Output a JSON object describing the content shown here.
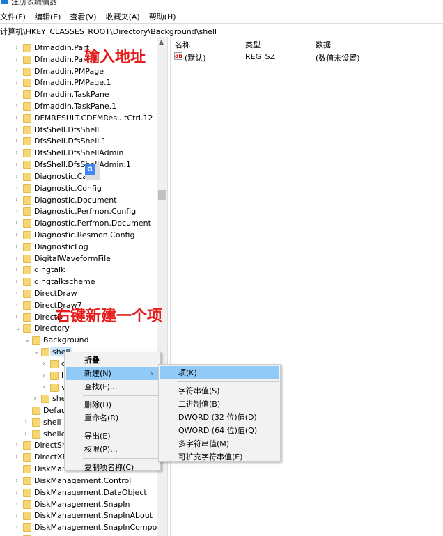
{
  "window": {
    "title": "注册表编辑器"
  },
  "menubar": [
    "文件(F)",
    "编辑(E)",
    "查看(V)",
    "收藏夹(A)",
    "帮助(H)"
  ],
  "address": "计算机\\HKEY_CLASSES_ROOT\\Directory\\Background\\shell",
  "tree": [
    {
      "label": "Dfmaddin.Part",
      "level": 0,
      "arrow": ">"
    },
    {
      "label": "Dfmaddin.Part.1",
      "level": 0,
      "arrow": ">"
    },
    {
      "label": "Dfmaddin.PMPage",
      "level": 0,
      "arrow": ">"
    },
    {
      "label": "Dfmaddin.PMPage.1",
      "level": 0,
      "arrow": ">"
    },
    {
      "label": "Dfmaddin.TaskPane",
      "level": 0,
      "arrow": ">"
    },
    {
      "label": "Dfmaddin.TaskPane.1",
      "level": 0,
      "arrow": ">"
    },
    {
      "label": "DFMRESULT.CDFMResultCtrl.12",
      "level": 0,
      "arrow": ">"
    },
    {
      "label": "DfsShell.DfsShell",
      "level": 0,
      "arrow": ">"
    },
    {
      "label": "DfsShell.DfsShell.1",
      "level": 0,
      "arrow": ">"
    },
    {
      "label": "DfsShell.DfsShellAdmin",
      "level": 0,
      "arrow": ">"
    },
    {
      "label": "DfsShell.DfsShellAdmin.1",
      "level": 0,
      "arrow": ">"
    },
    {
      "label": "Diagnostic.Cab",
      "level": 0,
      "arrow": ">"
    },
    {
      "label": "Diagnostic.Config",
      "level": 0,
      "arrow": ">"
    },
    {
      "label": "Diagnostic.Document",
      "level": 0,
      "arrow": ">"
    },
    {
      "label": "Diagnostic.Perfmon.Config",
      "level": 0,
      "arrow": ">"
    },
    {
      "label": "Diagnostic.Perfmon.Document",
      "level": 0,
      "arrow": ">"
    },
    {
      "label": "Diagnostic.Resmon.Config",
      "level": 0,
      "arrow": ">"
    },
    {
      "label": "DiagnosticLog",
      "level": 0,
      "arrow": ">"
    },
    {
      "label": "DigitalWaveformFile",
      "level": 0,
      "arrow": ">"
    },
    {
      "label": "dingtalk",
      "level": 0,
      "arrow": ">"
    },
    {
      "label": "dingtalkscheme",
      "level": 0,
      "arrow": ">"
    },
    {
      "label": "DirectDraw",
      "level": 0,
      "arrow": ">"
    },
    {
      "label": "DirectDraw7",
      "level": 0,
      "arrow": ">"
    },
    {
      "label": "DirectD",
      "level": 0,
      "arrow": ">"
    },
    {
      "label": "Directory",
      "level": 0,
      "arrow": "v"
    },
    {
      "label": "Background",
      "level": 1,
      "arrow": "v"
    },
    {
      "label": "shell",
      "level": 2,
      "arrow": "v",
      "selected": true
    },
    {
      "label": "c",
      "level": 3,
      "arrow": ">"
    },
    {
      "label": "l",
      "level": 3,
      "arrow": ">"
    },
    {
      "label": "v",
      "level": 3,
      "arrow": ">"
    },
    {
      "label": "she",
      "level": 2,
      "arrow": ">"
    },
    {
      "label": "Defau",
      "level": 1,
      "arrow": ""
    },
    {
      "label": "shell",
      "level": 1,
      "arrow": ">"
    },
    {
      "label": "shelle",
      "level": 1,
      "arrow": ">"
    },
    {
      "label": "DirectSho",
      "level": 0,
      "arrow": ">"
    },
    {
      "label": "DirectXFi",
      "level": 0,
      "arrow": ">"
    },
    {
      "label": "DiskMan",
      "level": 0,
      "arrow": ""
    },
    {
      "label": "DiskManagement.Control",
      "level": 0,
      "arrow": ">"
    },
    {
      "label": "DiskManagement.DataObject",
      "level": 0,
      "arrow": ">"
    },
    {
      "label": "DiskManagement.SnapIn",
      "level": 0,
      "arrow": ">"
    },
    {
      "label": "DiskManagement.SnapInAbout",
      "level": 0,
      "arrow": ">"
    },
    {
      "label": "DiskManagement.SnapInComponen",
      "level": 0,
      "arrow": ">"
    },
    {
      "label": "DiskManagement.SnapInExtension",
      "level": 0,
      "arrow": ">"
    }
  ],
  "values": {
    "headers": [
      "名称",
      "类型",
      "数据"
    ],
    "rows": [
      {
        "name": "(默认)",
        "type": "REG_SZ",
        "data": "(数值未设置)",
        "icon": "ab"
      }
    ]
  },
  "annotations": [
    "输入地址",
    "右键新建一个项"
  ],
  "context_menu": [
    {
      "label": "折叠",
      "bold": true
    },
    {
      "label": "新建(N)",
      "submenu": true,
      "highlighted": true
    },
    {
      "label": "查找(F)..."
    },
    {
      "sep": true
    },
    {
      "label": "删除(D)"
    },
    {
      "label": "重命名(R)"
    },
    {
      "sep": true
    },
    {
      "label": "导出(E)"
    },
    {
      "label": "权限(P)..."
    },
    {
      "sep": true
    },
    {
      "label": "复制项名称(C)"
    }
  ],
  "submenu": [
    {
      "label": "项(K)",
      "highlighted": true
    },
    {
      "sep": true
    },
    {
      "label": "字符串值(S)"
    },
    {
      "label": "二进制值(B)"
    },
    {
      "label": "DWORD (32 位)值(D)"
    },
    {
      "label": "QWORD (64 位)值(Q)"
    },
    {
      "label": "多字符串值(M)"
    },
    {
      "label": "可扩充字符串值(E)"
    }
  ],
  "colors": {
    "selection": "#cce8ff",
    "menu_highlight": "#91c9f7",
    "annotation": "#e51c1c",
    "folder": "#f7d774"
  }
}
